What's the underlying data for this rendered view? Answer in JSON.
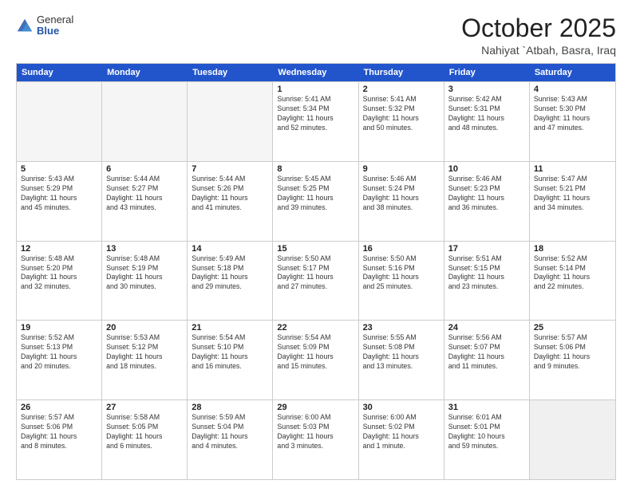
{
  "logo": {
    "general": "General",
    "blue": "Blue"
  },
  "header": {
    "month": "October 2025",
    "location": "Nahiyat `Atbah, Basra, Iraq"
  },
  "weekdays": [
    "Sunday",
    "Monday",
    "Tuesday",
    "Wednesday",
    "Thursday",
    "Friday",
    "Saturday"
  ],
  "rows": [
    [
      {
        "day": "",
        "empty": true
      },
      {
        "day": "",
        "empty": true
      },
      {
        "day": "",
        "empty": true
      },
      {
        "day": "1",
        "line1": "Sunrise: 5:41 AM",
        "line2": "Sunset: 5:34 PM",
        "line3": "Daylight: 11 hours",
        "line4": "and 52 minutes."
      },
      {
        "day": "2",
        "line1": "Sunrise: 5:41 AM",
        "line2": "Sunset: 5:32 PM",
        "line3": "Daylight: 11 hours",
        "line4": "and 50 minutes."
      },
      {
        "day": "3",
        "line1": "Sunrise: 5:42 AM",
        "line2": "Sunset: 5:31 PM",
        "line3": "Daylight: 11 hours",
        "line4": "and 48 minutes."
      },
      {
        "day": "4",
        "line1": "Sunrise: 5:43 AM",
        "line2": "Sunset: 5:30 PM",
        "line3": "Daylight: 11 hours",
        "line4": "and 47 minutes."
      }
    ],
    [
      {
        "day": "5",
        "line1": "Sunrise: 5:43 AM",
        "line2": "Sunset: 5:29 PM",
        "line3": "Daylight: 11 hours",
        "line4": "and 45 minutes."
      },
      {
        "day": "6",
        "line1": "Sunrise: 5:44 AM",
        "line2": "Sunset: 5:27 PM",
        "line3": "Daylight: 11 hours",
        "line4": "and 43 minutes."
      },
      {
        "day": "7",
        "line1": "Sunrise: 5:44 AM",
        "line2": "Sunset: 5:26 PM",
        "line3": "Daylight: 11 hours",
        "line4": "and 41 minutes."
      },
      {
        "day": "8",
        "line1": "Sunrise: 5:45 AM",
        "line2": "Sunset: 5:25 PM",
        "line3": "Daylight: 11 hours",
        "line4": "and 39 minutes."
      },
      {
        "day": "9",
        "line1": "Sunrise: 5:46 AM",
        "line2": "Sunset: 5:24 PM",
        "line3": "Daylight: 11 hours",
        "line4": "and 38 minutes."
      },
      {
        "day": "10",
        "line1": "Sunrise: 5:46 AM",
        "line2": "Sunset: 5:23 PM",
        "line3": "Daylight: 11 hours",
        "line4": "and 36 minutes."
      },
      {
        "day": "11",
        "line1": "Sunrise: 5:47 AM",
        "line2": "Sunset: 5:21 PM",
        "line3": "Daylight: 11 hours",
        "line4": "and 34 minutes."
      }
    ],
    [
      {
        "day": "12",
        "line1": "Sunrise: 5:48 AM",
        "line2": "Sunset: 5:20 PM",
        "line3": "Daylight: 11 hours",
        "line4": "and 32 minutes."
      },
      {
        "day": "13",
        "line1": "Sunrise: 5:48 AM",
        "line2": "Sunset: 5:19 PM",
        "line3": "Daylight: 11 hours",
        "line4": "and 30 minutes."
      },
      {
        "day": "14",
        "line1": "Sunrise: 5:49 AM",
        "line2": "Sunset: 5:18 PM",
        "line3": "Daylight: 11 hours",
        "line4": "and 29 minutes."
      },
      {
        "day": "15",
        "line1": "Sunrise: 5:50 AM",
        "line2": "Sunset: 5:17 PM",
        "line3": "Daylight: 11 hours",
        "line4": "and 27 minutes."
      },
      {
        "day": "16",
        "line1": "Sunrise: 5:50 AM",
        "line2": "Sunset: 5:16 PM",
        "line3": "Daylight: 11 hours",
        "line4": "and 25 minutes."
      },
      {
        "day": "17",
        "line1": "Sunrise: 5:51 AM",
        "line2": "Sunset: 5:15 PM",
        "line3": "Daylight: 11 hours",
        "line4": "and 23 minutes."
      },
      {
        "day": "18",
        "line1": "Sunrise: 5:52 AM",
        "line2": "Sunset: 5:14 PM",
        "line3": "Daylight: 11 hours",
        "line4": "and 22 minutes."
      }
    ],
    [
      {
        "day": "19",
        "line1": "Sunrise: 5:52 AM",
        "line2": "Sunset: 5:13 PM",
        "line3": "Daylight: 11 hours",
        "line4": "and 20 minutes."
      },
      {
        "day": "20",
        "line1": "Sunrise: 5:53 AM",
        "line2": "Sunset: 5:12 PM",
        "line3": "Daylight: 11 hours",
        "line4": "and 18 minutes."
      },
      {
        "day": "21",
        "line1": "Sunrise: 5:54 AM",
        "line2": "Sunset: 5:10 PM",
        "line3": "Daylight: 11 hours",
        "line4": "and 16 minutes."
      },
      {
        "day": "22",
        "line1": "Sunrise: 5:54 AM",
        "line2": "Sunset: 5:09 PM",
        "line3": "Daylight: 11 hours",
        "line4": "and 15 minutes."
      },
      {
        "day": "23",
        "line1": "Sunrise: 5:55 AM",
        "line2": "Sunset: 5:08 PM",
        "line3": "Daylight: 11 hours",
        "line4": "and 13 minutes."
      },
      {
        "day": "24",
        "line1": "Sunrise: 5:56 AM",
        "line2": "Sunset: 5:07 PM",
        "line3": "Daylight: 11 hours",
        "line4": "and 11 minutes."
      },
      {
        "day": "25",
        "line1": "Sunrise: 5:57 AM",
        "line2": "Sunset: 5:06 PM",
        "line3": "Daylight: 11 hours",
        "line4": "and 9 minutes."
      }
    ],
    [
      {
        "day": "26",
        "line1": "Sunrise: 5:57 AM",
        "line2": "Sunset: 5:06 PM",
        "line3": "Daylight: 11 hours",
        "line4": "and 8 minutes."
      },
      {
        "day": "27",
        "line1": "Sunrise: 5:58 AM",
        "line2": "Sunset: 5:05 PM",
        "line3": "Daylight: 11 hours",
        "line4": "and 6 minutes."
      },
      {
        "day": "28",
        "line1": "Sunrise: 5:59 AM",
        "line2": "Sunset: 5:04 PM",
        "line3": "Daylight: 11 hours",
        "line4": "and 4 minutes."
      },
      {
        "day": "29",
        "line1": "Sunrise: 6:00 AM",
        "line2": "Sunset: 5:03 PM",
        "line3": "Daylight: 11 hours",
        "line4": "and 3 minutes."
      },
      {
        "day": "30",
        "line1": "Sunrise: 6:00 AM",
        "line2": "Sunset: 5:02 PM",
        "line3": "Daylight: 11 hours",
        "line4": "and 1 minute."
      },
      {
        "day": "31",
        "line1": "Sunrise: 6:01 AM",
        "line2": "Sunset: 5:01 PM",
        "line3": "Daylight: 10 hours",
        "line4": "and 59 minutes."
      },
      {
        "day": "",
        "empty": true,
        "shaded": true
      }
    ]
  ]
}
